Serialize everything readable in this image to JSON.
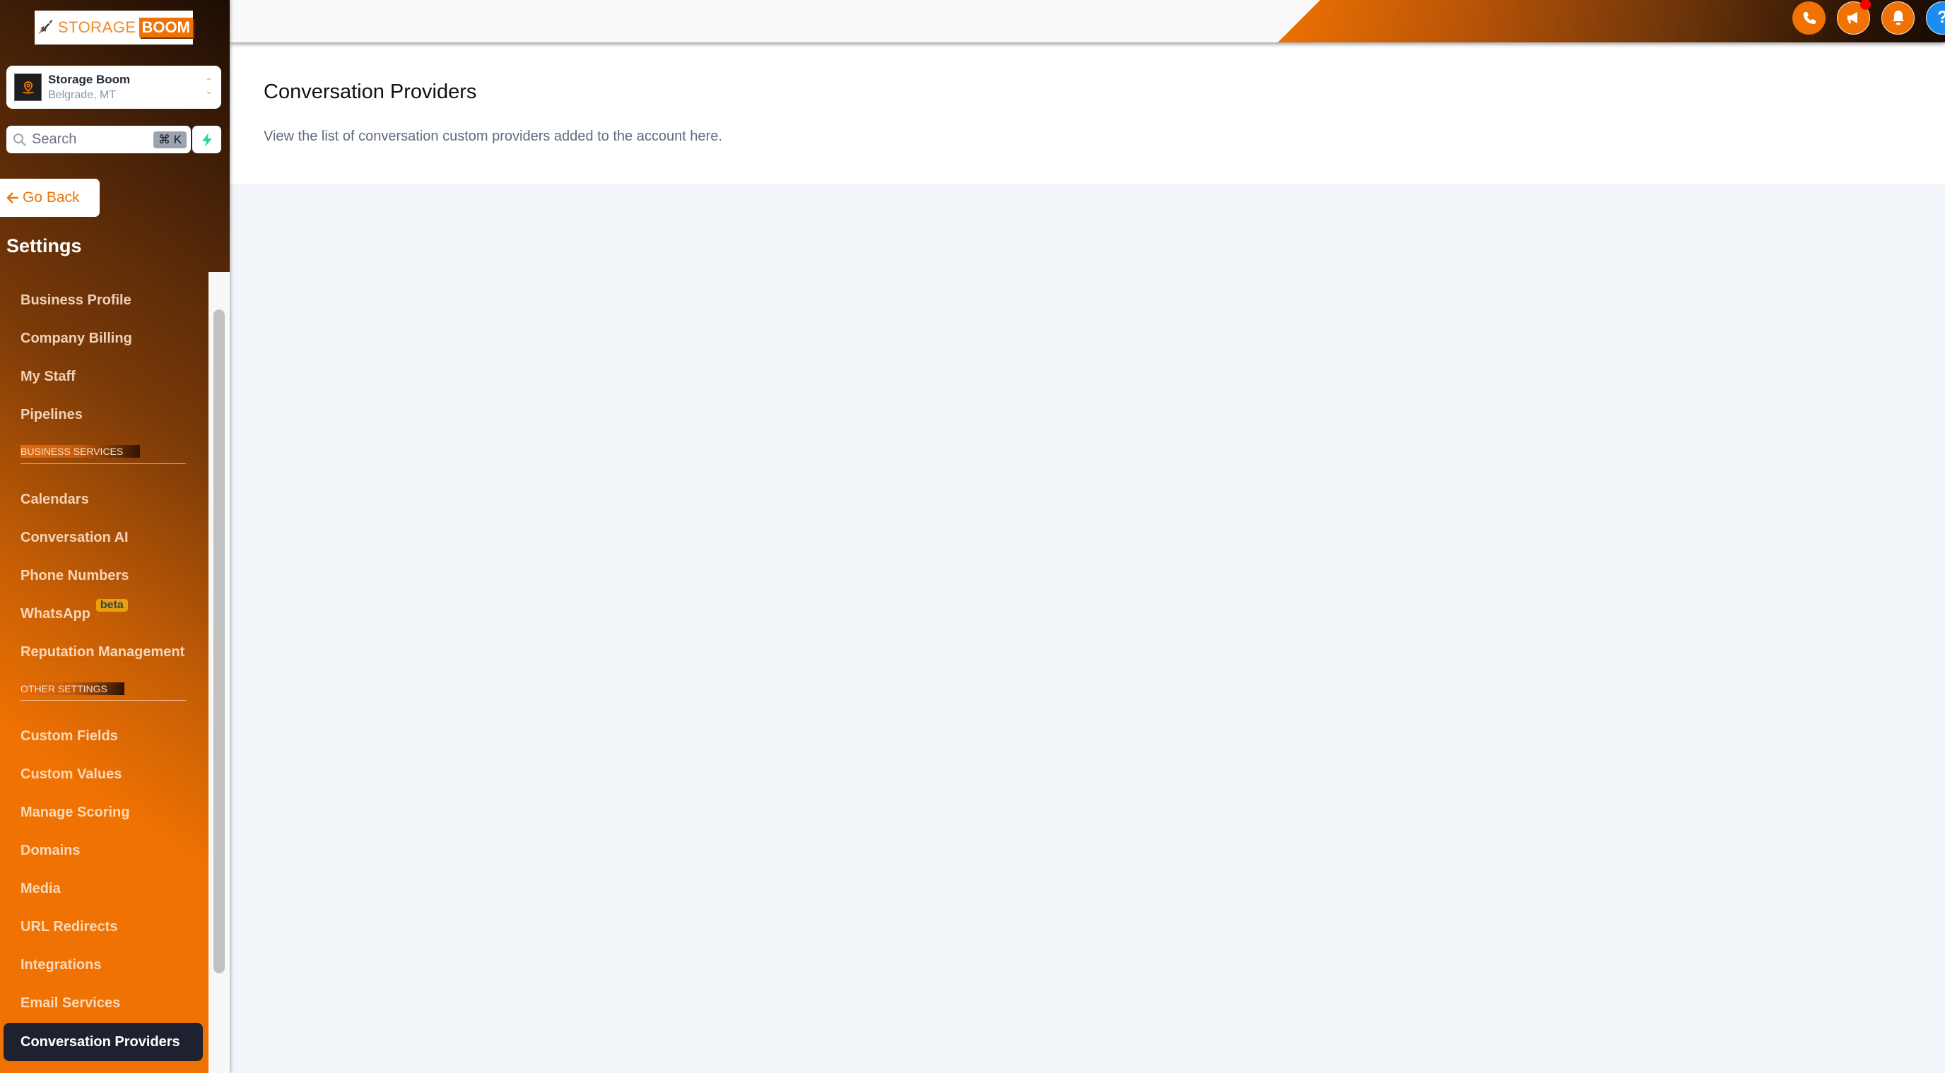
{
  "brand": {
    "logo_text_1": "STORAGE",
    "logo_text_2": "BOOM",
    "accent_color": "#ef7202"
  },
  "location_switcher": {
    "name": "Storage Boom",
    "city": "Belgrade, MT"
  },
  "search": {
    "placeholder": "Search",
    "shortcut": "⌘ K"
  },
  "sidebar": {
    "go_back_label": "Go Back",
    "title": "Settings",
    "items": [
      {
        "label": "Business Profile"
      },
      {
        "label": "Company Billing"
      },
      {
        "label": "My Staff"
      },
      {
        "label": "Pipelines"
      }
    ],
    "section_business": "BUSINESS SERVICES",
    "business_items": [
      {
        "label": "Calendars"
      },
      {
        "label": "Conversation AI"
      },
      {
        "label": "Phone Numbers"
      },
      {
        "label": "WhatsApp",
        "badge": "beta"
      },
      {
        "label": "Reputation Management"
      }
    ],
    "section_other": "OTHER SETTINGS",
    "other_items": [
      {
        "label": "Custom Fields"
      },
      {
        "label": "Custom Values"
      },
      {
        "label": "Manage Scoring"
      },
      {
        "label": "Domains"
      },
      {
        "label": "Media"
      },
      {
        "label": "URL Redirects"
      },
      {
        "label": "Integrations"
      },
      {
        "label": "Email Services"
      },
      {
        "label": "Conversation Providers",
        "active": true
      }
    ]
  },
  "topbar": {
    "icons": [
      "phone-icon",
      "megaphone-icon",
      "bell-icon",
      "help-icon"
    ],
    "has_notification_dot": true
  },
  "main": {
    "title": "Conversation Providers",
    "description": "View the list of conversation custom providers added to the account here."
  }
}
